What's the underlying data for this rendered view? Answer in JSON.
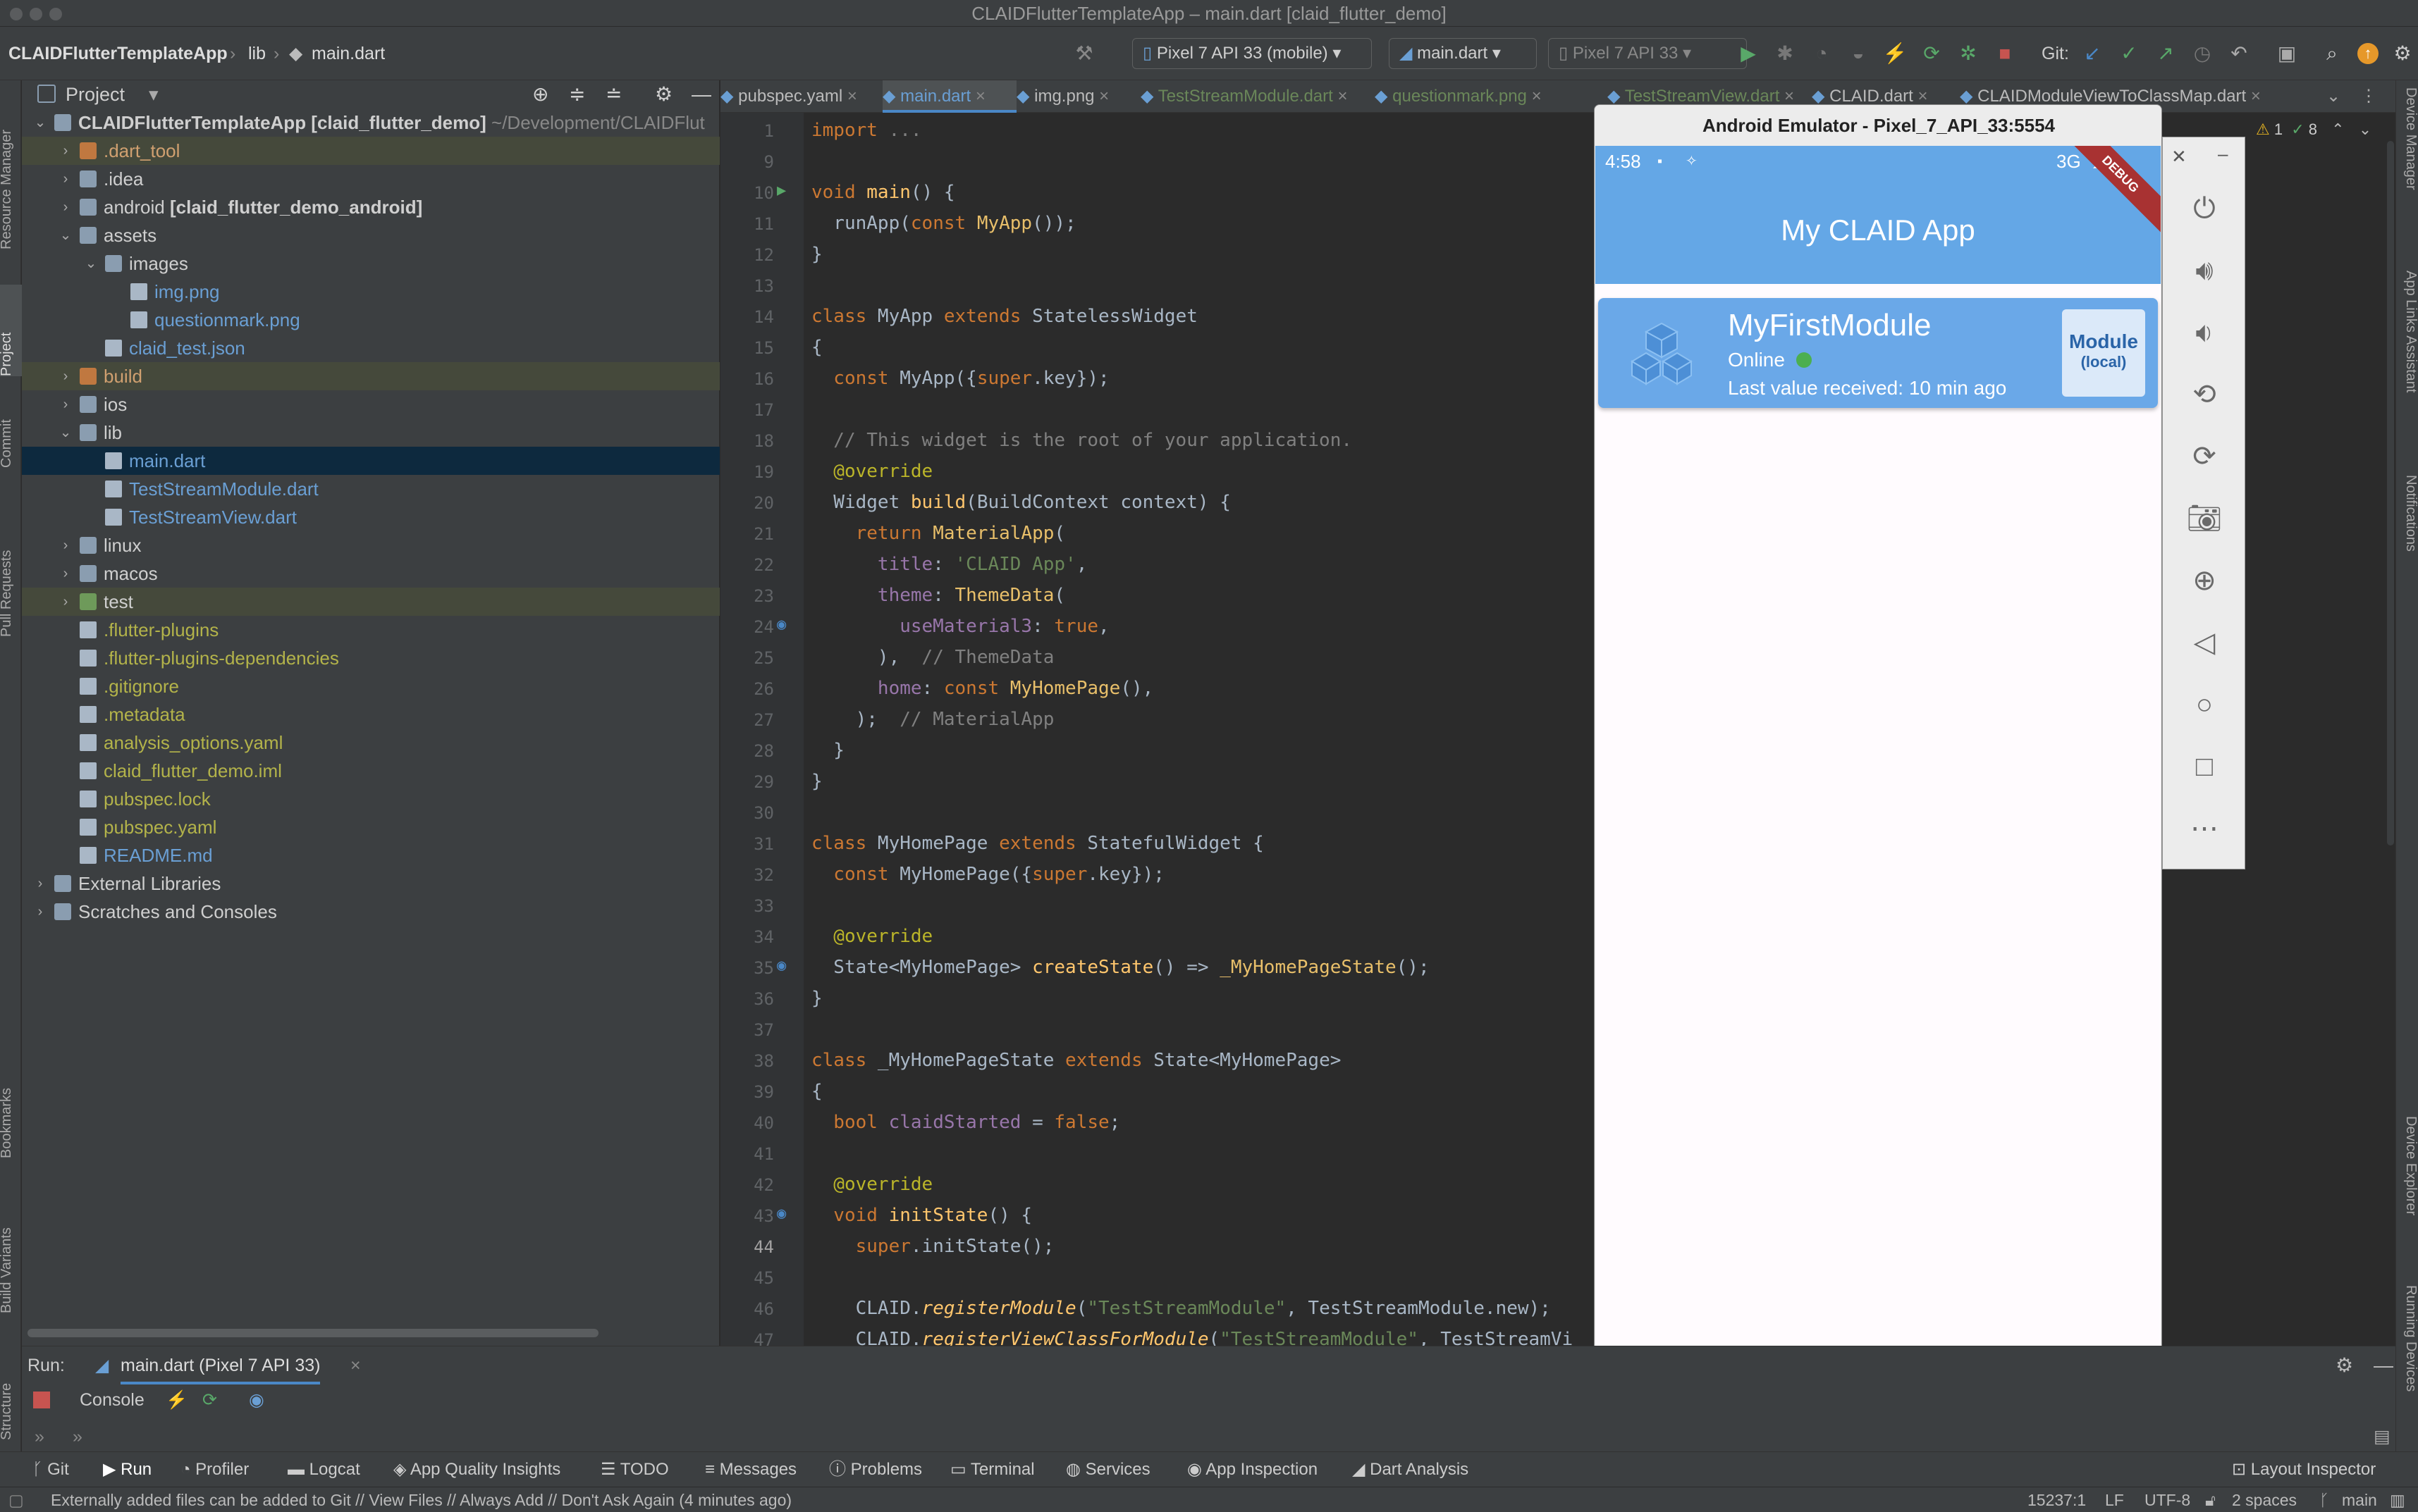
{
  "window": {
    "title": "CLAIDFlutterTemplateApp – main.dart [claid_flutter_demo]"
  },
  "navbar": {
    "breadcrumb": [
      "CLAIDFlutterTemplateApp",
      "lib",
      "main.dart"
    ],
    "device_selector": "Pixel 7 API 33 (mobile)",
    "run_config": "main.dart",
    "target_device": "Pixel 7 API 33",
    "git_label": "Git:"
  },
  "left_strip": [
    "Resource Manager",
    "Project",
    "Commit",
    "Pull Requests",
    "Bookmarks",
    "Build Variants",
    "Structure"
  ],
  "right_strip": [
    "Device Manager",
    "App Links Assistant",
    "Notifications",
    "Device Explorer",
    "Running Devices"
  ],
  "project": {
    "header": "Project",
    "tree": [
      {
        "label": "CLAIDFlutterTemplateApp",
        "suffix": " [claid_flutter_demo]",
        "path": " ~/Development/CLAIDFlut",
        "depth": 0,
        "arrow": "v",
        "type": "folder"
      },
      {
        "label": ".dart_tool",
        "depth": 1,
        "arrow": ">",
        "type": "folder-orange",
        "hl": true
      },
      {
        "label": ".idea",
        "depth": 1,
        "arrow": ">",
        "type": "folder"
      },
      {
        "label": "android",
        "suffix": " [claid_flutter_demo_android]",
        "depth": 1,
        "arrow": ">",
        "type": "folder"
      },
      {
        "label": "assets",
        "depth": 1,
        "arrow": "v",
        "type": "folder"
      },
      {
        "label": "images",
        "depth": 2,
        "arrow": "v",
        "type": "folder"
      },
      {
        "label": "img.png",
        "depth": 3,
        "type": "file"
      },
      {
        "label": "questionmark.png",
        "depth": 3,
        "type": "file"
      },
      {
        "label": "claid_test.json",
        "depth": 2,
        "type": "file"
      },
      {
        "label": "build",
        "depth": 1,
        "arrow": ">",
        "type": "folder-orange",
        "hl": true
      },
      {
        "label": "ios",
        "depth": 1,
        "arrow": ">",
        "type": "folder"
      },
      {
        "label": "lib",
        "depth": 1,
        "arrow": "v",
        "type": "folder"
      },
      {
        "label": "main.dart",
        "depth": 2,
        "type": "file",
        "selected": true
      },
      {
        "label": "TestStreamModule.dart",
        "depth": 2,
        "type": "file"
      },
      {
        "label": "TestStreamView.dart",
        "depth": 2,
        "type": "file"
      },
      {
        "label": "linux",
        "depth": 1,
        "arrow": ">",
        "type": "folder"
      },
      {
        "label": "macos",
        "depth": 1,
        "arrow": ">",
        "type": "folder"
      },
      {
        "label": "test",
        "depth": 1,
        "arrow": ">",
        "type": "folder-test",
        "hl": true
      },
      {
        "label": ".flutter-plugins",
        "depth": 1,
        "type": "file"
      },
      {
        "label": ".flutter-plugins-dependencies",
        "depth": 1,
        "type": "file"
      },
      {
        "label": ".gitignore",
        "depth": 1,
        "type": "file"
      },
      {
        "label": ".metadata",
        "depth": 1,
        "type": "file"
      },
      {
        "label": "analysis_options.yaml",
        "depth": 1,
        "type": "file"
      },
      {
        "label": "claid_flutter_demo.iml",
        "depth": 1,
        "type": "file"
      },
      {
        "label": "pubspec.lock",
        "depth": 1,
        "type": "file"
      },
      {
        "label": "pubspec.yaml",
        "depth": 1,
        "type": "file"
      },
      {
        "label": "README.md",
        "depth": 1,
        "type": "file"
      },
      {
        "label": "External Libraries",
        "depth": 0,
        "arrow": ">",
        "type": "lib"
      },
      {
        "label": "Scratches and Consoles",
        "depth": 0,
        "arrow": ">",
        "type": "scratch"
      }
    ]
  },
  "editor": {
    "tabs": [
      {
        "label": "pubspec.yaml"
      },
      {
        "label": "main.dart",
        "active": true
      },
      {
        "label": "img.png"
      },
      {
        "label": "TestStreamModule.dart"
      },
      {
        "label": "questionmark.png"
      },
      {
        "label": "TestStreamView.dart"
      },
      {
        "label": "CLAID.dart"
      },
      {
        "label": "CLAIDModuleViewToClassMap.dart"
      }
    ],
    "warnings": "1",
    "checks": "8",
    "lines": [
      {
        "n": "1",
        "code": [
          [
            "kw",
            "import "
          ],
          [
            "cm",
            "..."
          ]
        ]
      },
      {
        "n": "9",
        "code": []
      },
      {
        "n": "10",
        "code": [
          [
            "kw",
            "void "
          ],
          [
            "fn",
            "main"
          ],
          [
            "",
            "() {"
          ]
        ]
      },
      {
        "n": "11",
        "code": [
          [
            "",
            "  runApp("
          ],
          [
            "kw",
            "const "
          ],
          [
            "cls",
            "MyApp"
          ],
          [
            "",
            "());"
          ]
        ]
      },
      {
        "n": "12",
        "code": [
          [
            "",
            "}"
          ]
        ]
      },
      {
        "n": "13",
        "code": []
      },
      {
        "n": "14",
        "code": [
          [
            "kw",
            "class "
          ],
          [
            "",
            "MyApp "
          ],
          [
            "kw",
            "extends "
          ],
          [
            "",
            "StatelessWidget"
          ]
        ]
      },
      {
        "n": "15",
        "code": [
          [
            "",
            "{"
          ]
        ]
      },
      {
        "n": "16",
        "code": [
          [
            "kw",
            "  const "
          ],
          [
            "",
            "MyApp({"
          ],
          [
            "kw",
            "super"
          ],
          [
            "",
            ".key});"
          ]
        ]
      },
      {
        "n": "17",
        "code": []
      },
      {
        "n": "18",
        "code": [
          [
            "cm",
            "  // This widget is the root of your application."
          ]
        ]
      },
      {
        "n": "19",
        "code": [
          [
            "an",
            "  @override"
          ]
        ]
      },
      {
        "n": "20",
        "code": [
          [
            "",
            "  Widget "
          ],
          [
            "fn",
            "build"
          ],
          [
            "",
            "(BuildContext context) {"
          ]
        ]
      },
      {
        "n": "21",
        "code": [
          [
            "kw",
            "    return "
          ],
          [
            "cls",
            "MaterialApp"
          ],
          [
            "",
            "("
          ]
        ]
      },
      {
        "n": "22",
        "code": [
          [
            "pu",
            "      title"
          ],
          [
            "",
            ": "
          ],
          [
            "str",
            "'CLAID App'"
          ],
          [
            "",
            ","
          ]
        ]
      },
      {
        "n": "23",
        "code": [
          [
            "pu",
            "      theme"
          ],
          [
            "",
            ": "
          ],
          [
            "cls",
            "ThemeData"
          ],
          [
            "",
            "("
          ]
        ]
      },
      {
        "n": "24",
        "code": [
          [
            "pu",
            "        useMaterial3"
          ],
          [
            "",
            ": "
          ],
          [
            "kw",
            "true"
          ],
          [
            "",
            ","
          ]
        ]
      },
      {
        "n": "25",
        "code": [
          [
            "",
            "      ),  "
          ],
          [
            "cm",
            "// ThemeData"
          ]
        ]
      },
      {
        "n": "26",
        "code": [
          [
            "pu",
            "      home"
          ],
          [
            "",
            ": "
          ],
          [
            "kw",
            "const "
          ],
          [
            "cls",
            "MyHomePage"
          ],
          [
            "",
            "(),"
          ]
        ]
      },
      {
        "n": "27",
        "code": [
          [
            "",
            "    );  "
          ],
          [
            "cm",
            "// MaterialApp"
          ]
        ]
      },
      {
        "n": "28",
        "code": [
          [
            "",
            "  }"
          ]
        ]
      },
      {
        "n": "29",
        "code": [
          [
            "",
            "}"
          ]
        ]
      },
      {
        "n": "30",
        "code": []
      },
      {
        "n": "31",
        "code": [
          [
            "kw",
            "class "
          ],
          [
            "",
            "MyHomePage "
          ],
          [
            "kw",
            "extends "
          ],
          [
            "",
            "StatefulWidget {"
          ]
        ]
      },
      {
        "n": "32",
        "code": [
          [
            "kw",
            "  const "
          ],
          [
            "",
            "MyHomePage({"
          ],
          [
            "kw",
            "super"
          ],
          [
            "",
            ".key});"
          ]
        ]
      },
      {
        "n": "33",
        "code": []
      },
      {
        "n": "34",
        "code": [
          [
            "an",
            "  @override"
          ]
        ]
      },
      {
        "n": "35",
        "code": [
          [
            "",
            "  State<MyHomePage> "
          ],
          [
            "fn",
            "createState"
          ],
          [
            "",
            "() => "
          ],
          [
            "cls",
            "_MyHomePageState"
          ],
          [
            "",
            "();"
          ]
        ]
      },
      {
        "n": "36",
        "code": [
          [
            "",
            "}"
          ]
        ]
      },
      {
        "n": "37",
        "code": []
      },
      {
        "n": "38",
        "code": [
          [
            "kw",
            "class "
          ],
          [
            "",
            "_MyHomePageState "
          ],
          [
            "kw",
            "extends "
          ],
          [
            "",
            "State<MyHomePage>"
          ]
        ]
      },
      {
        "n": "39",
        "code": [
          [
            "",
            "{"
          ]
        ]
      },
      {
        "n": "40",
        "code": [
          [
            "kw",
            "  bool "
          ],
          [
            "pu",
            "claidStarted"
          ],
          [
            "",
            " = "
          ],
          [
            "kw",
            "false"
          ],
          [
            "",
            ";"
          ]
        ]
      },
      {
        "n": "41",
        "code": []
      },
      {
        "n": "42",
        "code": [
          [
            "an",
            "  @override"
          ]
        ]
      },
      {
        "n": "43",
        "code": [
          [
            "kw",
            "  void "
          ],
          [
            "fn",
            "initState"
          ],
          [
            "",
            "() {"
          ]
        ]
      },
      {
        "n": "44",
        "code": [
          [
            "kw",
            "    super"
          ],
          [
            "",
            ".initState();"
          ]
        ]
      },
      {
        "n": "45",
        "code": []
      },
      {
        "n": "46",
        "code": [
          [
            "",
            "    CLAID."
          ],
          [
            "it",
            "registerModule"
          ],
          [
            "",
            "("
          ],
          [
            "str",
            "\"TestStreamModule\""
          ],
          [
            "",
            ", TestStreamModule.new);"
          ]
        ]
      },
      {
        "n": "47",
        "code": [
          [
            "",
            "    CLAID."
          ],
          [
            "it",
            "registerViewClassForModule"
          ],
          [
            "",
            "("
          ],
          [
            "str",
            "\"TestStreamModule\""
          ],
          [
            "",
            ", TestStreamVi"
          ]
        ]
      }
    ]
  },
  "emulator": {
    "title": "Android Emulator - Pixel_7_API_33:5554",
    "status_time": "4:58",
    "status_network": "3G",
    "debug_banner": "DEBUG",
    "app_title": "My CLAID App",
    "module_card": {
      "name": "MyFirstModule",
      "status": "Online",
      "last_value": "Last value received: 10 min ago",
      "badge_title": "Module",
      "badge_sub": "(local)",
      "status_color": "#4caf50"
    },
    "side_icons": [
      "power-icon",
      "volume-up-icon",
      "volume-down-icon",
      "rotate-left-icon",
      "rotate-right-icon",
      "camera-icon",
      "zoom-icon",
      "back-icon",
      "home-icon",
      "overview-icon",
      "more-icon"
    ]
  },
  "run": {
    "label": "Run:",
    "config_tab": "main.dart (Pixel 7 API 33)",
    "console_tab": "Console"
  },
  "bottom_tools": [
    "Git",
    "Run",
    "Profiler",
    "Logcat",
    "App Quality Insights",
    "TODO",
    "Messages",
    "Problems",
    "Terminal",
    "Services",
    "App Inspection",
    "Dart Analysis"
  ],
  "layout_inspector": "Layout Inspector",
  "statusbar": {
    "message": "Externally added files can be added to Git // View Files // Always Add // Don't Ask Again (4 minutes ago)",
    "position": "15237:1",
    "line_sep": "LF",
    "encoding": "UTF-8",
    "indent": "2 spaces",
    "branch": "main"
  },
  "colors": {
    "accent": "#4a88c7",
    "app_blue": "#64a7e6",
    "card_blue": "#6aa8e8",
    "online": "#4caf50"
  }
}
